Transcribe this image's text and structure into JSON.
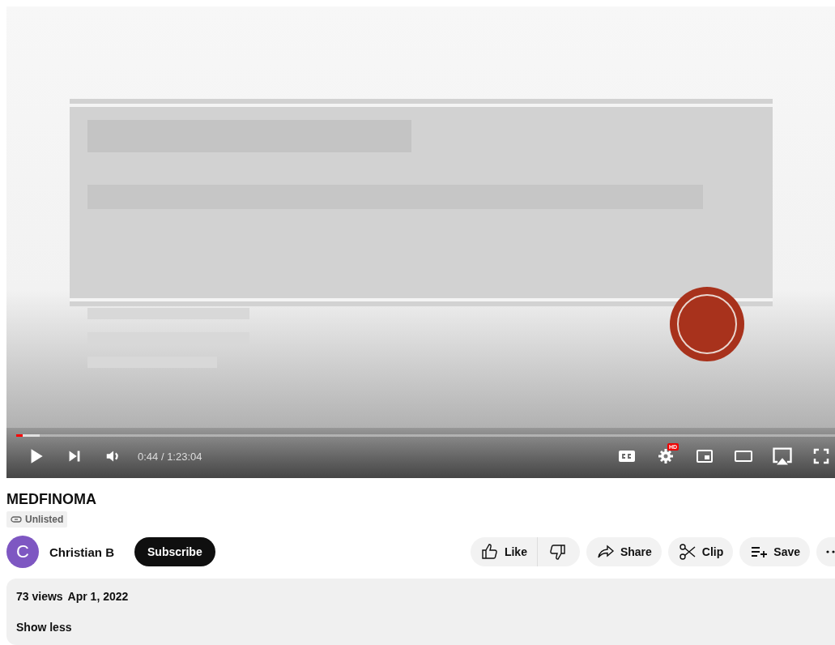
{
  "player": {
    "progress": {
      "level": 0.008
    },
    "buffered": {
      "level": 0.028
    },
    "time": "0:44 / 1:23:04",
    "quality_badge": "HD"
  },
  "video": {
    "title": "MEDFINOMA",
    "visibility": "Unlisted"
  },
  "channel": {
    "avatar_letter": "C",
    "name": "Christian B",
    "subscribe": "Subscribe"
  },
  "actions": [
    {
      "kind": "like",
      "label": "Like"
    },
    {
      "kind": "share",
      "label": "Share"
    },
    {
      "kind": "clip",
      "label": "Clip"
    },
    {
      "kind": "save",
      "label": "Save"
    },
    {
      "kind": "more"
    }
  ],
  "description": {
    "views": "73 views",
    "date": "Apr 1, 2022",
    "toggle": "Show less"
  }
}
